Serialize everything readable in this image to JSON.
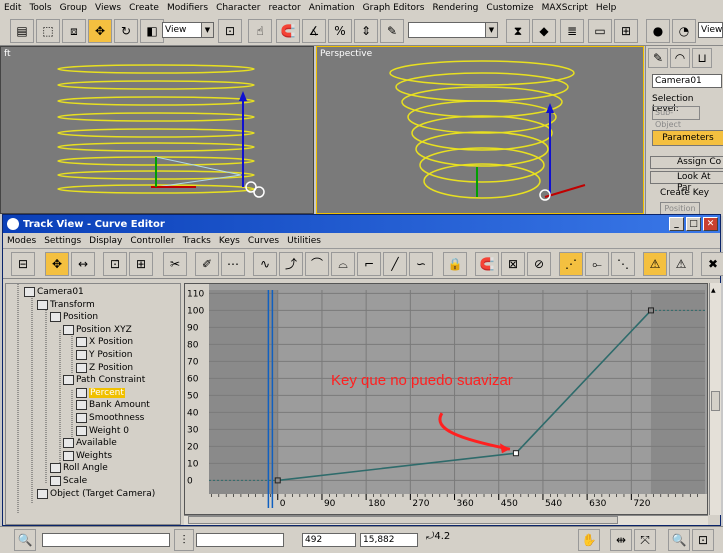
{
  "menubar": {
    "items": [
      "Edit",
      "Tools",
      "Group",
      "Views",
      "Create",
      "Modifiers",
      "Character",
      "reactor",
      "Animation",
      "Graph Editors",
      "Rendering",
      "Customize",
      "MAXScript",
      "Help"
    ]
  },
  "toolbar": {
    "view_combo": "View",
    "right_view_combo": "View"
  },
  "viewports": {
    "left_label": "ft",
    "right_label": "Perspective"
  },
  "command_panel": {
    "object_name": "Camera01",
    "selection_level": "Selection Level:",
    "sub_object": "Sub-Object",
    "parameters": "Parameters",
    "assign_controller": "Assign Co",
    "look_at": "Look At Par",
    "create_key": "Create Key",
    "position": "Position"
  },
  "track_view": {
    "title": "Track View - Curve Editor",
    "menu": [
      "Modes",
      "Settings",
      "Display",
      "Controller",
      "Tracks",
      "Keys",
      "Curves",
      "Utilities"
    ],
    "tree": [
      {
        "label": "Camera01",
        "indent": 0
      },
      {
        "label": "Transform",
        "indent": 1
      },
      {
        "label": "Position",
        "indent": 2
      },
      {
        "label": "Position XYZ",
        "indent": 3
      },
      {
        "label": "X Position",
        "indent": 4
      },
      {
        "label": "Y Position",
        "indent": 4
      },
      {
        "label": "Z Position",
        "indent": 4
      },
      {
        "label": "Path Constraint",
        "indent": 3
      },
      {
        "label": "Percent",
        "indent": 4,
        "selected": true
      },
      {
        "label": "Bank Amount",
        "indent": 4
      },
      {
        "label": "Smoothness",
        "indent": 4
      },
      {
        "label": "Weight 0",
        "indent": 4
      },
      {
        "label": "Available",
        "indent": 3
      },
      {
        "label": "Weights",
        "indent": 3
      },
      {
        "label": "Roll Angle",
        "indent": 2
      },
      {
        "label": "Scale",
        "indent": 2
      },
      {
        "label": "Object (Target Camera)",
        "indent": 1
      }
    ],
    "annotation": "Key que no puedo suavizar",
    "annotation_color": "#ff2020",
    "curve_color": "#2e6b6b"
  },
  "chart_data": {
    "type": "line",
    "title": "",
    "xlabel": "",
    "ylabel": "",
    "x_ticks": [
      "0",
      "90",
      "180",
      "270",
      "360",
      "450",
      "540",
      "630",
      "720"
    ],
    "y_ticks": [
      "0",
      "10",
      "20",
      "30",
      "40",
      "50",
      "60",
      "70",
      "80",
      "90",
      "100",
      "110"
    ],
    "xlim": [
      -140,
      870
    ],
    "ylim": [
      -8,
      112
    ],
    "series": [
      {
        "x": [
          0,
          485,
          760
        ],
        "y": [
          0,
          16,
          100
        ]
      }
    ],
    "grid": true,
    "time_slider_frame": -15
  },
  "status": {
    "field_x": "492",
    "field_y": "15,882",
    "zoom_value": "4.2"
  }
}
